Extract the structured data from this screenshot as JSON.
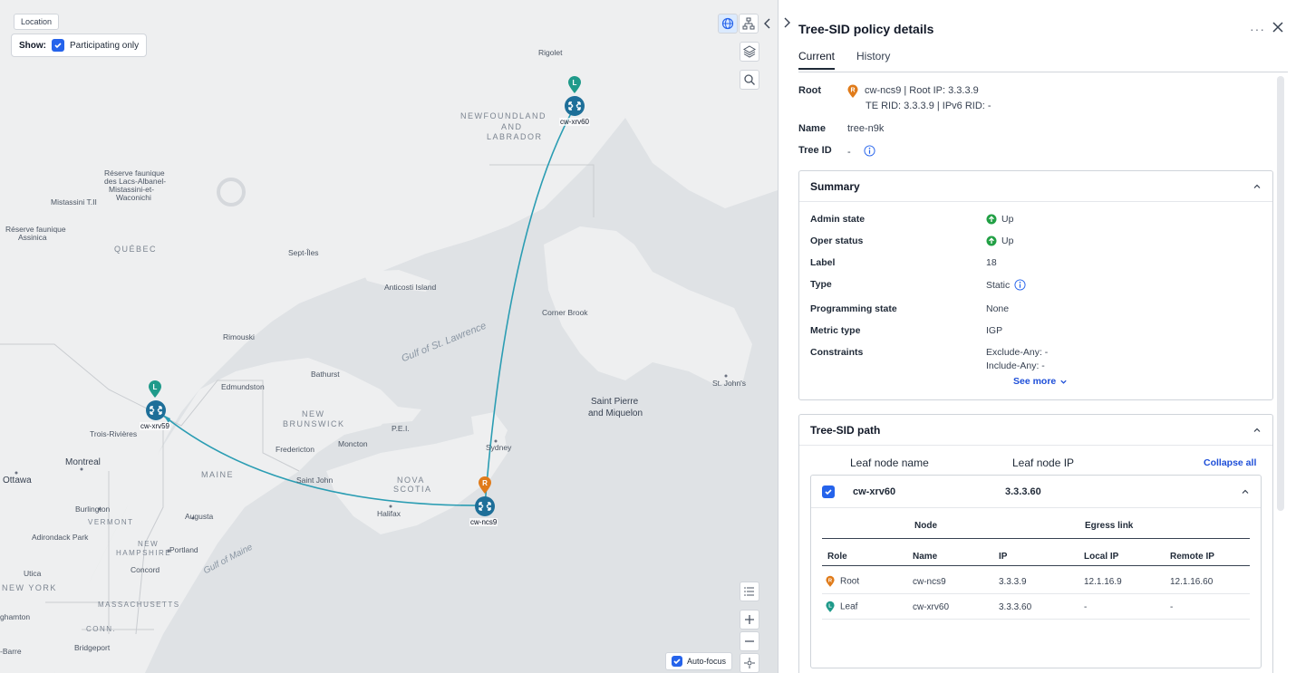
{
  "map": {
    "location_tag": "Location",
    "show_label": "Show:",
    "participating_only": "Participating only",
    "auto_focus": "Auto-focus",
    "labels": {
      "rigolet": "Rigolet",
      "newfoundland": "NEWFOUNDLAND",
      "and": "AND",
      "labrador": "LABRADOR",
      "reserve1": "Réserve faunique",
      "reserve1b": "des Lacs-Albanel-",
      "reserve1c": "Mistassini-et-",
      "reserve1d": "Waconichi",
      "mistassini": "Mistassini T.II",
      "reserve2": "Réserve faunique",
      "reserve2b": "Assinica",
      "quebec": "QUÉBEC",
      "septiles": "Sept-Îles",
      "anticosti": "Anticosti Island",
      "cornerbrook": "Corner Brook",
      "rimouski": "Rimouski",
      "gulf": "Gulf of St. Lawrence",
      "bathurst": "Bathurst",
      "edmundston": "Edmundston",
      "newbrunswick1": "NEW",
      "newbrunswick2": "BRUNSWICK",
      "pei": "P.E.I.",
      "stjohns": "St. John's",
      "stpierre1": "Saint Pierre",
      "stpierre2": "and Miquelon",
      "sydney": "Sydney",
      "troisrivieres": "Trois-Rivières",
      "fredericton": "Fredericton",
      "moncton": "Moncton",
      "montreal": "Montreal",
      "ottawa": "Ottawa",
      "maine": "MAINE",
      "saintjohn": "Saint John",
      "novascotia1": "NOVA",
      "novascotia2": "SCOTIA",
      "burlington": "Burlington",
      "vermont": "VERMONT",
      "augusta": "Augusta",
      "halifax": "Halifax",
      "adirondack": "Adirondack Park",
      "newhampshire1": "NEW",
      "newhampshire2": "HAMPSHIRE",
      "portland": "Portland",
      "gulfmaine": "Gulf of Maine",
      "utica": "Utica",
      "concord": "Concord",
      "newyork": "NEW YORK",
      "massachusetts": "MASSACHUSETTS",
      "binghamton": "ghamton",
      "conn": "CONN.",
      "bridgeport": "Bridgeport",
      "barre": "-Barre"
    },
    "nodes": {
      "xrv60": "cw-xrv60",
      "xrv59": "cw-xrv59",
      "ncs9": "cw-ncs9"
    },
    "pins": {
      "leaf": "L",
      "root": "R"
    }
  },
  "panel": {
    "title": "Tree-SID policy details",
    "tabs": [
      "Current",
      "History"
    ],
    "root_label": "Root",
    "root_line1": "cw-ncs9 | Root IP: 3.3.3.9",
    "root_line2": "TE RID: 3.3.3.9 | IPv6 RID: -",
    "name_label": "Name",
    "name_value": "tree-n9k",
    "treeid_label": "Tree ID",
    "treeid_value": "-",
    "summary": {
      "title": "Summary",
      "rows": [
        {
          "k": "Admin state",
          "v": "Up"
        },
        {
          "k": "Oper status",
          "v": "Up"
        },
        {
          "k": "Label",
          "v": "18"
        },
        {
          "k": "Type",
          "v": "Static"
        },
        {
          "k": "Programming state",
          "v": "None"
        },
        {
          "k": "Metric type",
          "v": "IGP"
        },
        {
          "k": "Constraints",
          "v": "Exclude-Any: -",
          "v2": "Include-Any: -"
        }
      ],
      "see_more": "See more"
    },
    "path": {
      "title": "Tree-SID path",
      "col_leaf_name": "Leaf node name",
      "col_leaf_ip": "Leaf node IP",
      "collapse_all": "Collapse all",
      "leaf": {
        "name": "cw-xrv60",
        "ip": "3.3.3.60",
        "group_node": "Node",
        "group_egress": "Egress link",
        "headers": [
          "Role",
          "Name",
          "IP",
          "Local IP",
          "Remote IP"
        ],
        "rows": [
          [
            "Root",
            "cw-ncs9",
            "3.3.3.9",
            "12.1.16.9",
            "12.1.16.60"
          ],
          [
            "Leaf",
            "cw-xrv60",
            "3.3.3.60",
            "-",
            "-"
          ]
        ]
      }
    }
  },
  "colors": {
    "accent": "#2563eb",
    "link": "#2b9db3",
    "root_pin": "#e07b1a",
    "leaf_pin": "#1f9a8a",
    "router": "#1e6f99",
    "up": "#22a045"
  }
}
